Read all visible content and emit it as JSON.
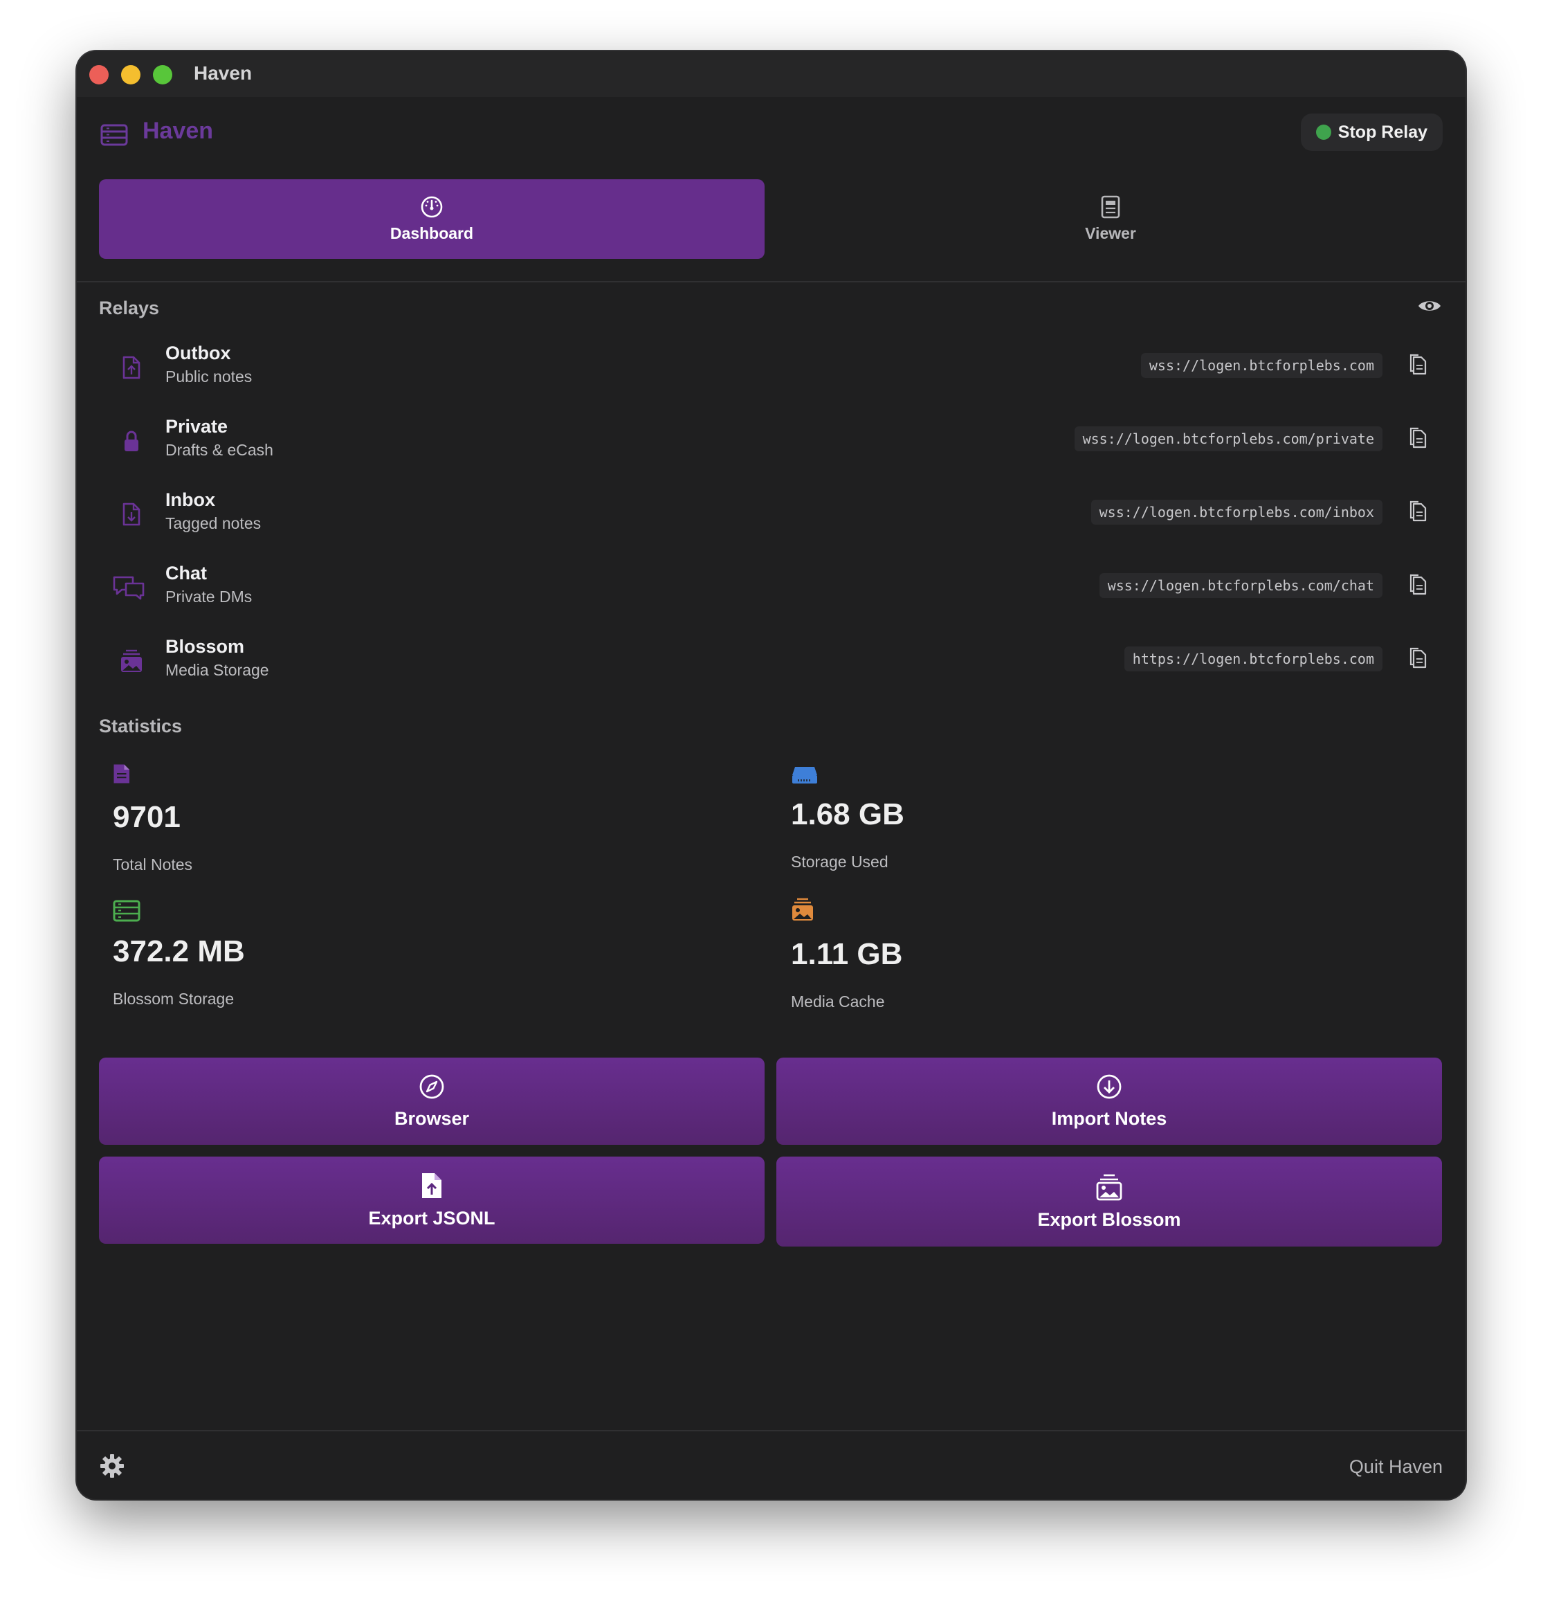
{
  "window": {
    "title": "Haven"
  },
  "header": {
    "app_name": "Haven",
    "relay_button": "Stop Relay",
    "relay_status_color": "#3fa34d",
    "brand_color": "#6b3a9b"
  },
  "tabs": [
    {
      "label": "Dashboard",
      "icon": "gauge-icon",
      "active": true
    },
    {
      "label": "Viewer",
      "icon": "document-icon",
      "active": false
    }
  ],
  "relays": {
    "title": "Relays",
    "items": [
      {
        "name": "Outbox",
        "subtitle": "Public notes",
        "url": "wss://logen.btcforplebs.com",
        "icon": "file-upload-icon"
      },
      {
        "name": "Private",
        "subtitle": "Drafts & eCash",
        "url": "wss://logen.btcforplebs.com/private",
        "icon": "lock-icon"
      },
      {
        "name": "Inbox",
        "subtitle": "Tagged notes",
        "url": "wss://logen.btcforplebs.com/inbox",
        "icon": "file-download-icon"
      },
      {
        "name": "Chat",
        "subtitle": "Private DMs",
        "url": "wss://logen.btcforplebs.com/chat",
        "icon": "chat-bubbles-icon"
      },
      {
        "name": "Blossom",
        "subtitle": "Media Storage",
        "url": "https://logen.btcforplebs.com",
        "icon": "photo-stack-icon"
      }
    ]
  },
  "statistics": {
    "title": "Statistics",
    "items": [
      {
        "value": "9701",
        "label": "Total Notes",
        "icon": "document-icon",
        "color": "#6a3396"
      },
      {
        "value": "1.68 GB",
        "label": "Storage Used",
        "icon": "hard-drive-icon",
        "color": "#3e7fd8"
      },
      {
        "value": "372.2 MB",
        "label": "Blossom Storage",
        "icon": "server-icon",
        "color": "#4cae4f"
      },
      {
        "value": "1.11 GB",
        "label": "Media Cache",
        "icon": "photo-stack-icon",
        "color": "#e08a3c"
      }
    ]
  },
  "actions": [
    {
      "label": "Browser",
      "icon": "compass-icon"
    },
    {
      "label": "Import Notes",
      "icon": "download-circle-icon"
    },
    {
      "label": "Export JSONL",
      "icon": "file-upload-icon"
    },
    {
      "label": "Export Blossom",
      "icon": "photo-stack-icon"
    }
  ],
  "footer": {
    "quit_label": "Quit Haven",
    "settings_icon": "gear-icon"
  }
}
